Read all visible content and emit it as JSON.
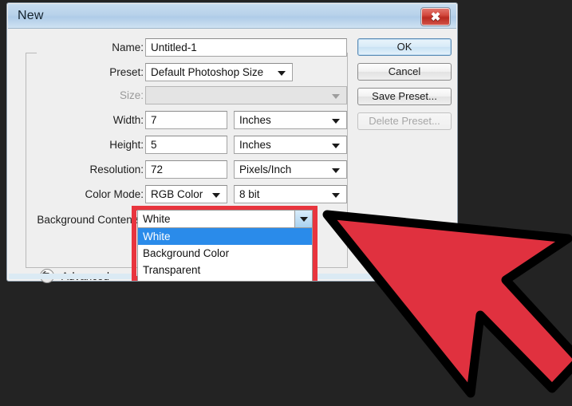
{
  "window": {
    "title": "New",
    "close_label": "✖",
    "close_icon": "close-icon"
  },
  "form": {
    "rows": [
      {
        "label": "Name:",
        "value": "Untitled-1",
        "type": "text",
        "disabled": false
      },
      {
        "label": "Preset:",
        "value": "Default Photoshop Size",
        "type": "combo",
        "disabled": false
      },
      {
        "label": "Size:",
        "value": "",
        "type": "combo",
        "disabled": true
      },
      {
        "label": "Width:",
        "value": "7",
        "unit": "Inches",
        "type": "text-unit",
        "disabled": false
      },
      {
        "label": "Height:",
        "value": "5",
        "unit": "Inches",
        "type": "text-unit",
        "disabled": false
      },
      {
        "label": "Resolution:",
        "value": "72",
        "unit": "Pixels/Inch",
        "type": "text-unit",
        "disabled": false
      },
      {
        "label": "Color Mode:",
        "value": "RGB Color",
        "unit": "8 bit",
        "type": "combo-combo",
        "disabled": false
      },
      {
        "label": "Background Contents:",
        "value": "White",
        "type": "combo-open",
        "disabled": false
      }
    ]
  },
  "background_contents": {
    "label": "Background Contents:",
    "selected": "White",
    "options": [
      {
        "label": "White",
        "selected": true
      },
      {
        "label": "Background Color",
        "selected": false
      },
      {
        "label": "Transparent",
        "selected": false
      }
    ]
  },
  "buttons": [
    {
      "label": "OK",
      "style": "primary",
      "disabled": false
    },
    {
      "label": "Cancel",
      "style": "normal",
      "disabled": false
    },
    {
      "label": "Save Preset...",
      "style": "normal",
      "disabled": false
    },
    {
      "label": "Delete Preset...",
      "style": "normal",
      "disabled": true
    }
  ],
  "advanced": {
    "label": "Advanced",
    "icon": "chevron-double-down-icon"
  },
  "annotation": {
    "highlight_color": "#e8353e",
    "arrow_fill": "#e0313f",
    "arrow_stroke": "#000000",
    "arrow_name": "pointer-cursor-arrow"
  },
  "colors": {
    "desktop_background": "#232323",
    "dialog_background": "#efefef",
    "titlebar_top": "#c7dcef",
    "titlebar_bottom": "#cfe2f2",
    "selection_blue": "#2a8bea",
    "close_red": "#b92a20"
  }
}
